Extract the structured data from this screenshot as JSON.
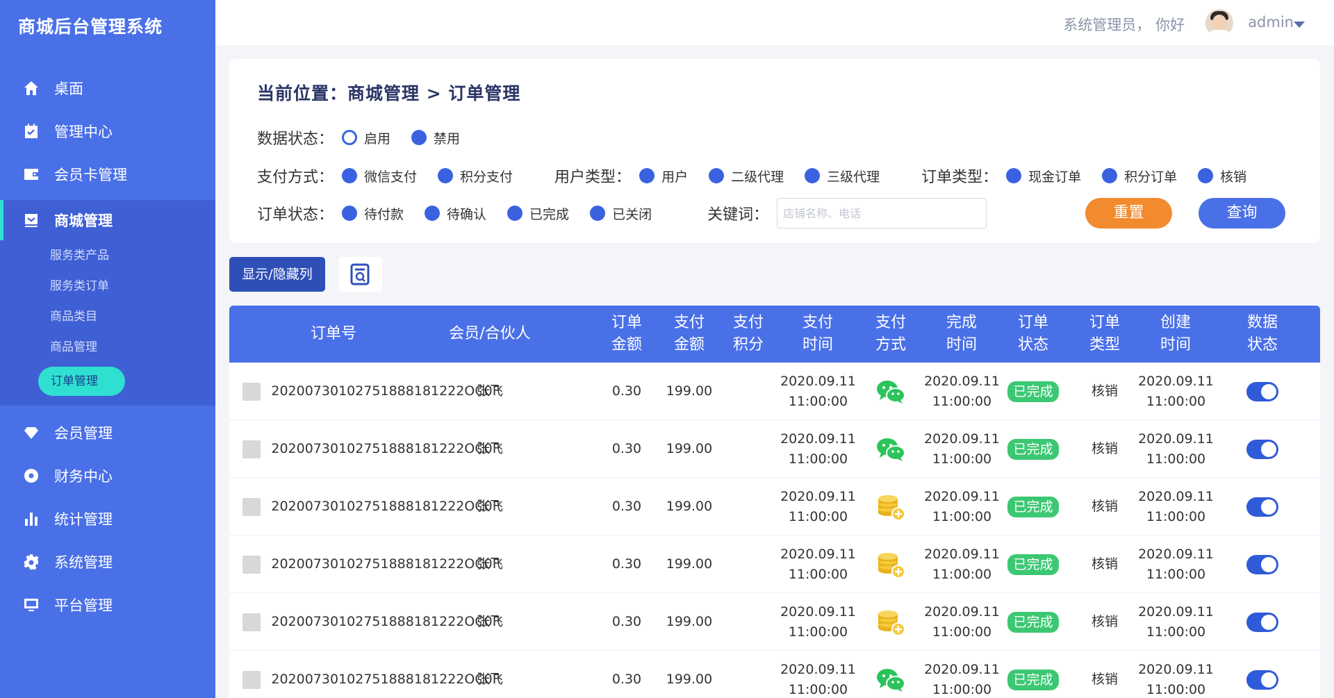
{
  "app": {
    "title": "商城后台管理系统"
  },
  "sidebar": {
    "top_items": [
      {
        "label": "桌面",
        "icon": "home-icon"
      },
      {
        "label": "管理中心",
        "icon": "calendar-icon"
      },
      {
        "label": "会员卡管理",
        "icon": "wallet-icon"
      }
    ],
    "active_group": {
      "label": "商城管理",
      "icon": "monitor-icon",
      "children": [
        "服务类产品",
        "服务类订单",
        "商品类目",
        "商品管理",
        "订单管理"
      ],
      "active_child": "订单管理"
    },
    "bottom_items": [
      {
        "label": "会员管理",
        "icon": "diamond-icon"
      },
      {
        "label": "财务中心",
        "icon": "coin-circle-icon"
      },
      {
        "label": "统计管理",
        "icon": "bar-chart-icon"
      },
      {
        "label": "系统管理",
        "icon": "gear-icon"
      },
      {
        "label": "平台管理",
        "icon": "screen-icon"
      }
    ]
  },
  "header": {
    "greeting": "系统管理员， 你好",
    "username": "admin"
  },
  "filters": {
    "breadcrumb": "当前位置：商城管理 > 订单管理",
    "data_status": {
      "label": "数据状态：",
      "options": [
        "启用",
        "禁用"
      ]
    },
    "pay_method": {
      "label": "支付方式：",
      "options": [
        "微信支付",
        "积分支付"
      ]
    },
    "user_type": {
      "label": "用户类型：",
      "options": [
        "用户",
        "二级代理",
        "三级代理"
      ]
    },
    "order_type": {
      "label": "订单类型：",
      "options": [
        "现金订单",
        "积分订单",
        "核销"
      ]
    },
    "order_status": {
      "label": "订单状态：",
      "options": [
        "待付款",
        "待确认",
        "已完成",
        "已关闭"
      ]
    },
    "keyword": {
      "label": "关键词：",
      "placeholder": "店铺名称、电话",
      "value": ""
    },
    "reset_label": "重置",
    "query_label": "查询"
  },
  "toolbar": {
    "toggle_columns_label": "显示/隐藏列"
  },
  "table": {
    "headers": {
      "order_no": "订单号",
      "member": "会员/合伙人",
      "order_amount": "订单\n金额",
      "pay_amount": "支付\n金额",
      "pay_points": "支付\n积分",
      "pay_time": "支付\n时间",
      "pay_method": "支付\n方式",
      "finish_time": "完成\n时间",
      "order_status": "订单\n状态",
      "order_type": "订单\n类型",
      "create_time": "创建\n时间",
      "data_status": "数据\n状态"
    },
    "rows": [
      {
        "order_no": "20200730102751888181222OC0F",
        "member": "张飞",
        "order_amount": "0.30",
        "pay_amount": "199.00",
        "pay_points": "",
        "pay_time": "2020.09.11\n11:00:00",
        "pay_method": "wechat",
        "finish_time": "2020.09.11\n11:00:00",
        "status": "已完成",
        "type": "核销",
        "create_time": "2020.09.11\n11:00:00"
      },
      {
        "order_no": "20200730102751888181222OC0F",
        "member": "张飞",
        "order_amount": "0.30",
        "pay_amount": "199.00",
        "pay_points": "",
        "pay_time": "2020.09.11\n11:00:00",
        "pay_method": "wechat",
        "finish_time": "2020.09.11\n11:00:00",
        "status": "已完成",
        "type": "核销",
        "create_time": "2020.09.11\n11:00:00"
      },
      {
        "order_no": "20200730102751888181222OC0F",
        "member": "张飞",
        "order_amount": "0.30",
        "pay_amount": "199.00",
        "pay_points": "",
        "pay_time": "2020.09.11\n11:00:00",
        "pay_method": "points",
        "finish_time": "2020.09.11\n11:00:00",
        "status": "已完成",
        "type": "核销",
        "create_time": "2020.09.11\n11:00:00"
      },
      {
        "order_no": "20200730102751888181222OC0F",
        "member": "张飞",
        "order_amount": "0.30",
        "pay_amount": "199.00",
        "pay_points": "",
        "pay_time": "2020.09.11\n11:00:00",
        "pay_method": "points",
        "finish_time": "2020.09.11\n11:00:00",
        "status": "已完成",
        "type": "核销",
        "create_time": "2020.09.11\n11:00:00"
      },
      {
        "order_no": "20200730102751888181222OC0F",
        "member": "张飞",
        "order_amount": "0.30",
        "pay_amount": "199.00",
        "pay_points": "",
        "pay_time": "2020.09.11\n11:00:00",
        "pay_method": "points",
        "finish_time": "2020.09.11\n11:00:00",
        "status": "已完成",
        "type": "核销",
        "create_time": "2020.09.11\n11:00:00"
      },
      {
        "order_no": "20200730102751888181222OC0F",
        "member": "张飞",
        "order_amount": "0.30",
        "pay_amount": "199.00",
        "pay_points": "",
        "pay_time": "2020.09.11\n11:00:00",
        "pay_method": "wechat",
        "finish_time": "2020.09.11\n11:00:00",
        "status": "已完成",
        "type": "核销",
        "create_time": "2020.09.11\n11:00:00"
      }
    ]
  },
  "colors": {
    "sidebar": "#4a70e8",
    "accent_teal": "#2fe0d0",
    "reset_orange": "#f28a2e",
    "success_green": "#3cc873"
  }
}
